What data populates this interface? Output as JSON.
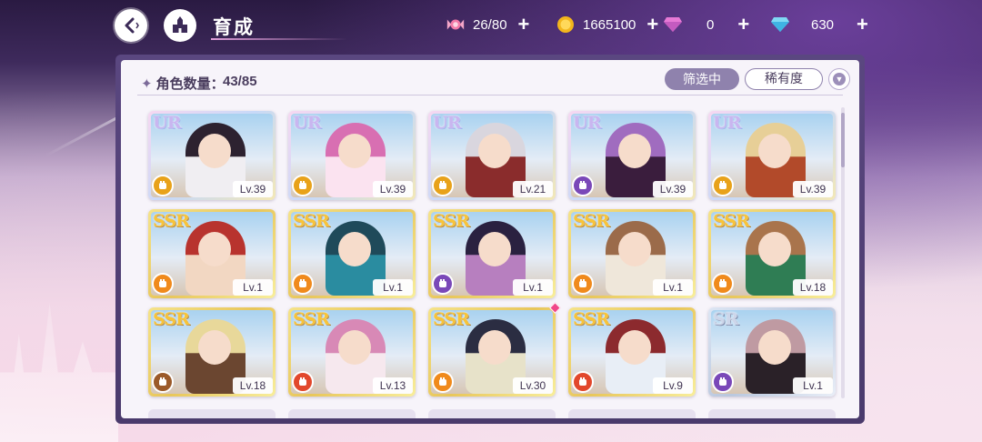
{
  "header": {
    "title": "育成",
    "back_icon": "back-arrow-icon",
    "home_icon": "castle-home-icon"
  },
  "resources": [
    {
      "name": "candy",
      "icon": "candy-icon",
      "value": "26/80",
      "plus": "+"
    },
    {
      "name": "coin",
      "icon": "gold-coin-icon",
      "value": "1665100",
      "plus": "+"
    },
    {
      "name": "pink-gem",
      "icon": "pink-diamond-icon",
      "value": "0",
      "plus": "+"
    },
    {
      "name": "blue-gem",
      "icon": "blue-diamond-icon",
      "value": "630",
      "plus": "+"
    }
  ],
  "panel": {
    "count_label": "角色数量：",
    "count_value": "43/85",
    "filter_label": "筛选中",
    "rarity_label": "稀有度"
  },
  "characters": [
    {
      "rarity": "UR",
      "level": "Lv.39",
      "type": "gold",
      "type_icon": "fist-icon"
    },
    {
      "rarity": "UR",
      "level": "Lv.39",
      "type": "gold",
      "type_icon": "hammer-icon"
    },
    {
      "rarity": "UR",
      "level": "Lv.21",
      "type": "gold",
      "type_icon": "hand-icon"
    },
    {
      "rarity": "UR",
      "level": "Lv.39",
      "type": "purple",
      "type_icon": "fist-icon"
    },
    {
      "rarity": "UR",
      "level": "Lv.39",
      "type": "gold",
      "type_icon": "fist-icon"
    },
    {
      "rarity": "SSR",
      "level": "Lv.1",
      "type": "orange",
      "type_icon": "fist-icon"
    },
    {
      "rarity": "SSR",
      "level": "Lv.1",
      "type": "orange",
      "type_icon": "hammer-icon"
    },
    {
      "rarity": "SSR",
      "level": "Lv.1",
      "type": "purple",
      "type_icon": "hand-icon"
    },
    {
      "rarity": "SSR",
      "level": "Lv.1",
      "type": "orange",
      "type_icon": "hand-icon"
    },
    {
      "rarity": "SSR",
      "level": "Lv.18",
      "type": "orange",
      "type_icon": "hand-icon"
    },
    {
      "rarity": "SSR",
      "level": "Lv.18",
      "type": "brown",
      "type_icon": "shield-icon"
    },
    {
      "rarity": "SSR",
      "level": "Lv.13",
      "type": "red",
      "type_icon": "hand-icon"
    },
    {
      "rarity": "SSR",
      "level": "Lv.30",
      "type": "orange",
      "type_icon": "hand-icon",
      "new": true
    },
    {
      "rarity": "SSR",
      "level": "Lv.9",
      "type": "red",
      "type_icon": "hand-icon"
    },
    {
      "rarity": "SR",
      "level": "Lv.1",
      "type": "purple",
      "type_icon": "fist-icon"
    }
  ],
  "colors": {
    "panel_frame": "#5a4780",
    "filter_active": "#8f82ad",
    "new_badge": "#f0478a"
  }
}
